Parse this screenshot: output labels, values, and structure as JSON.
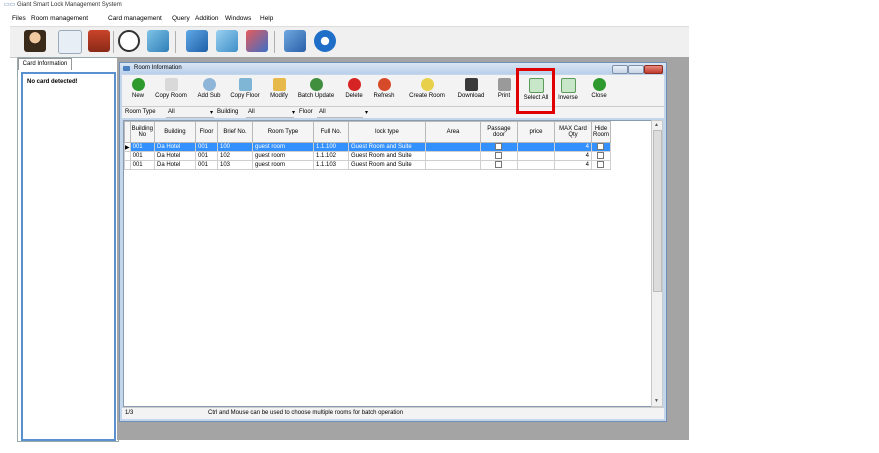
{
  "app": {
    "title": "Giant Smart Lock Management System"
  },
  "menu": [
    "Files",
    "Room management",
    "Card management",
    "Query",
    "Addition",
    "Windows",
    "Help"
  ],
  "main_toolbar_icons": [
    "user-icon",
    "network-icon",
    "card-reader-icon",
    "gauge-icon",
    "gift-icon",
    "pencil-icon",
    "key-icon",
    "shield-icon",
    "help-icon",
    "power-icon"
  ],
  "left_panel": {
    "tab": "Card Information",
    "message": "No card detected!"
  },
  "window": {
    "title": "Room Information",
    "toolbar": [
      {
        "label": "New",
        "icon": "plus-icon",
        "color": "#2e9a2e"
      },
      {
        "label": "Copy Room",
        "icon": "copy-icon",
        "color": "#d9d9d9"
      },
      {
        "label": "Add Sub",
        "icon": "add-sub-icon",
        "color": "#8fb5d9"
      },
      {
        "label": "Copy Floor",
        "icon": "copy-floor-icon",
        "color": "#7fb6d6"
      },
      {
        "label": "Modify",
        "icon": "pencil-icon",
        "color": "#e6b94a"
      },
      {
        "label": "Batch Update",
        "icon": "batch-update-icon",
        "color": "#3f8f3f"
      },
      {
        "label": "Delete",
        "icon": "minus-icon",
        "color": "#d62424"
      },
      {
        "label": "Refresh",
        "icon": "refresh-icon",
        "color": "#d64a2a"
      },
      {
        "label": "Create Room",
        "icon": "bulb-icon",
        "color": "#e8d04a"
      },
      {
        "label": "Download",
        "icon": "download-icon",
        "color": "#3a3a3a"
      },
      {
        "label": "Print",
        "icon": "printer-icon",
        "color": "#9a9a9a"
      },
      {
        "label": "Select All",
        "icon": "select-all-icon",
        "color": "#c8e6c8"
      },
      {
        "label": "Inverse",
        "icon": "inverse-icon",
        "color": "#c8e6c8"
      },
      {
        "label": "Close",
        "icon": "close-icon",
        "color": "#2e9a2e"
      }
    ],
    "filters": {
      "room_type_label": "Room Type",
      "room_type_value": "All",
      "building_label": "Building",
      "building_value": "All",
      "floor_label": "Floor",
      "floor_value": "All"
    },
    "columns": [
      "Building No",
      "Building",
      "Floor",
      "Brief No.",
      "Room Type",
      "Full No.",
      "lock type",
      "Area",
      "Passage door",
      "price",
      "MAX Card Qty",
      "Hide Room"
    ],
    "rows": [
      {
        "building_no": "001",
        "building": "Da Hotel",
        "floor": "001",
        "brief": "100",
        "room_type": "guest room",
        "full_no": "1.1.100",
        "lock_type": "Guest Room and Suite",
        "area": "",
        "price": "",
        "max_card": "4"
      },
      {
        "building_no": "001",
        "building": "Da Hotel",
        "floor": "001",
        "brief": "102",
        "room_type": "guest room",
        "full_no": "1.1.102",
        "lock_type": "Guest Room and Suite",
        "area": "",
        "price": "",
        "max_card": "4"
      },
      {
        "building_no": "001",
        "building": "Da Hotel",
        "floor": "001",
        "brief": "103",
        "room_type": "guest room",
        "full_no": "1.1.103",
        "lock_type": "Guest Room and Suite",
        "area": "",
        "price": "",
        "max_card": "4"
      }
    ],
    "status": {
      "page": "1/3",
      "hint": "Ctrl and Mouse can be used to choose multiple rooms for batch operation"
    }
  },
  "colors": {
    "selected_row": "#3390ff",
    "highlight": "#e00000",
    "window_bg": "#c3d6ec"
  }
}
